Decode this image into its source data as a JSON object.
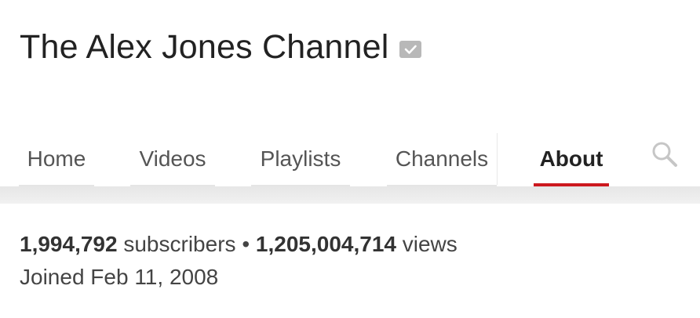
{
  "channel": {
    "title": "The Alex Jones Channel",
    "verified_icon": "verified-check-icon"
  },
  "tabs": [
    {
      "label": "Home"
    },
    {
      "label": "Videos"
    },
    {
      "label": "Playlists"
    },
    {
      "label": "Channels"
    },
    {
      "label": "About"
    }
  ],
  "active_tab": "About",
  "search_icon": "search-icon",
  "stats": {
    "subscribers_count": "1,994,792",
    "subscribers_label": "subscribers",
    "separator": "•",
    "views_count": "1,205,004,714",
    "views_label": "views",
    "joined": "Joined Feb 11, 2008"
  },
  "colors": {
    "active_tab_underline": "#cc181e",
    "title_text": "#222222"
  }
}
